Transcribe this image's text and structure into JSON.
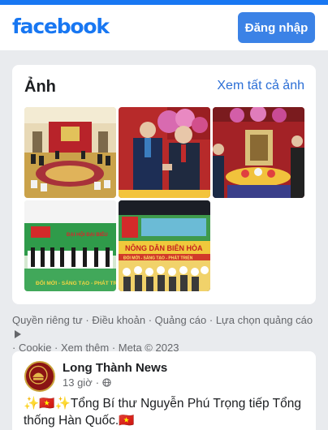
{
  "header": {
    "logo_text": "facebook",
    "login_label": "Đăng nhập",
    "brand_color": "#1877f2"
  },
  "photos": {
    "title": "Ảnh",
    "see_all_label": "Xem tất cả ảnh",
    "items": [
      {
        "name": "photo-meeting-hall"
      },
      {
        "name": "photo-handshake"
      },
      {
        "name": "photo-reception-flowers"
      },
      {
        "name": "photo-congress-stage"
      },
      {
        "name": "photo-farmers-event"
      }
    ],
    "banner_1": "ĐẠI HỘI ĐẠI BIỂU",
    "banner_1b": "ĐỔI MỚI - SÁNG TẠO - PHÁT TRIỂN",
    "banner_2": "NÔNG DÂN BIÊN HÒA",
    "banner_2b": "ĐỔI MỚI - SÁNG TẠO - PHÁT TRIỂN"
  },
  "footer": {
    "links": [
      "Quyền riêng tư",
      "Điều khoản",
      "Quảng cáo",
      "Lựa chọn quảng cáo",
      "Cookie",
      "Xem thêm"
    ],
    "copyright": "Meta © 2023",
    "separator": " · "
  },
  "post": {
    "page_name": "Long Thành News",
    "time": "13 giờ",
    "meta_sep": "·",
    "privacy_icon": "globe-icon",
    "text": "✨🇻🇳✨Tổng Bí thư Nguyễn Phú Trọng tiếp Tổng thống Hàn Quốc.🇻🇳"
  }
}
